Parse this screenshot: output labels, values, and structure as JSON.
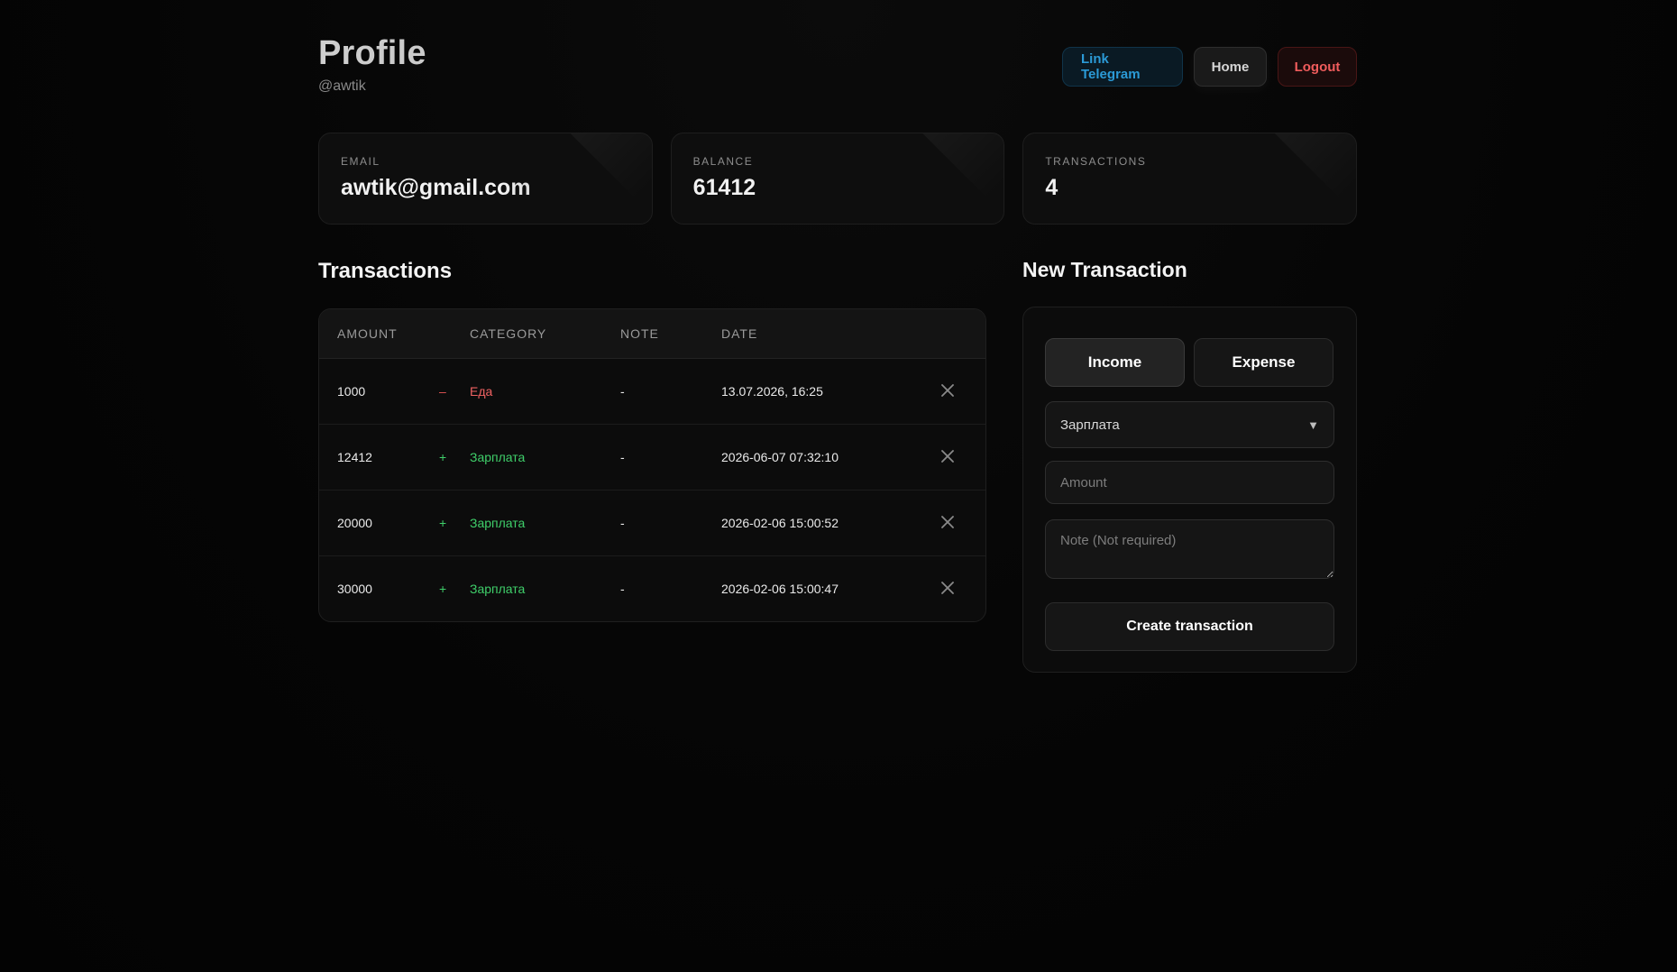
{
  "header": {
    "title": "Profile",
    "handle": "@awtik",
    "buttons": {
      "telegram": "Link Telegram",
      "home": "Home",
      "logout": "Logout"
    }
  },
  "stats": [
    {
      "label": "EMAIL",
      "value": "awtik@gmail.com"
    },
    {
      "label": "BALANCE",
      "value": "61412"
    },
    {
      "label": "TRANSACTIONS",
      "value": "4"
    }
  ],
  "transactions": {
    "title": "Transactions",
    "columns": [
      "AMOUNT",
      "CATEGORY",
      "NOTE",
      "DATE"
    ],
    "rows": [
      {
        "amount": "1000",
        "sign": "–",
        "type": "expense",
        "category": "Еда",
        "note": "-",
        "date": "13.07.2026, 16:25"
      },
      {
        "amount": "12412",
        "sign": "+",
        "type": "income",
        "category": "Зарплата",
        "note": "-",
        "date": "2026-06-07 07:32:10"
      },
      {
        "amount": "20000",
        "sign": "+",
        "type": "income",
        "category": "Зарплата",
        "note": "-",
        "date": "2026-02-06 15:00:52"
      },
      {
        "amount": "30000",
        "sign": "+",
        "type": "income",
        "category": "Зарплата",
        "note": "-",
        "date": "2026-02-06 15:00:47"
      }
    ],
    "delete_icon": "close-icon"
  },
  "new_transaction": {
    "title": "New Transaction",
    "type_options": [
      "Income",
      "Expense"
    ],
    "active_type": "Income",
    "category_selected": "Зарплата",
    "amount_placeholder": "Amount",
    "note_placeholder": "Note (Not required)",
    "submit_label": "Create transaction"
  },
  "colors": {
    "background": "#050505",
    "income": "#3fcf6a",
    "expense": "#f06262",
    "telegram": "#2b9ad6",
    "logout": "#f05c5c"
  }
}
